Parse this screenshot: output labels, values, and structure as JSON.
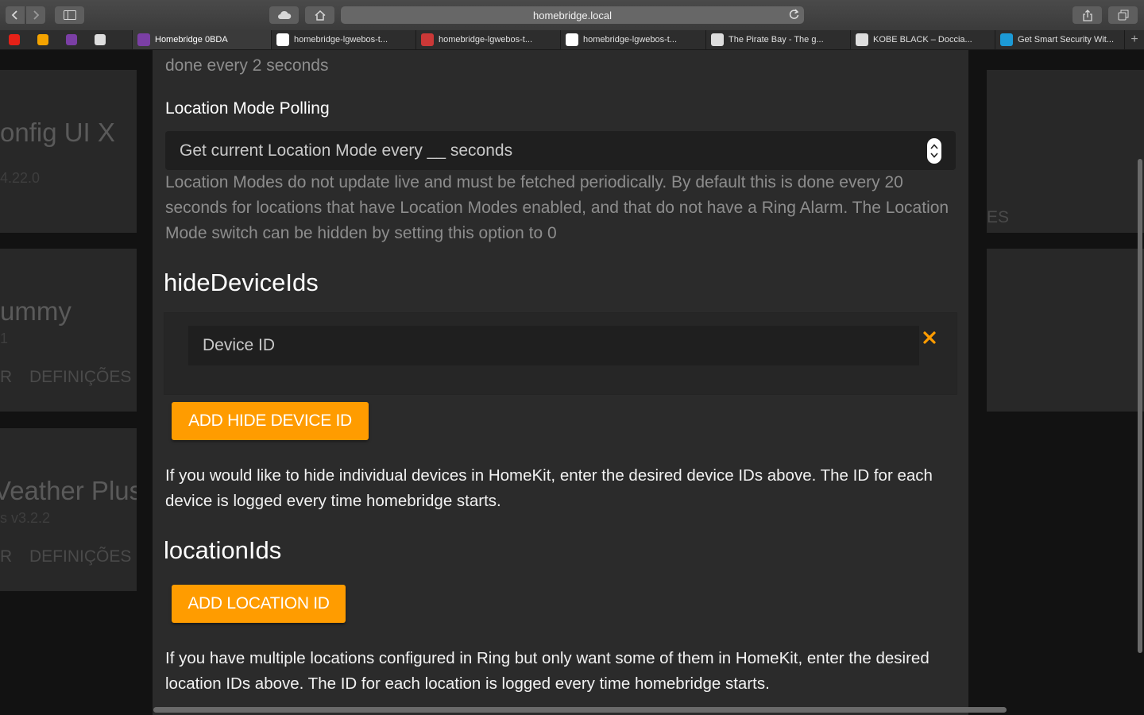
{
  "browser": {
    "address": "homebridge.local",
    "pinned": [
      {
        "name": "youtube-icon",
        "color": "#e62117"
      },
      {
        "name": "brave-lion-icon",
        "color": "#f4a300"
      },
      {
        "name": "homebridge-icon",
        "color": "#7b3fa5"
      },
      {
        "name": "library-icon",
        "color": "#dddddd"
      }
    ],
    "tabs": [
      {
        "title": "Homebridge 0BDA",
        "icon": "homebridge-icon",
        "color": "#7b3fa5",
        "active": true
      },
      {
        "title": "homebridge-lgwebos-t...",
        "icon": "github-icon",
        "color": "#ffffff",
        "active": false
      },
      {
        "title": "homebridge-lgwebos-t...",
        "icon": "npm-icon",
        "color": "#cb3837",
        "active": false
      },
      {
        "title": "homebridge-lgwebos-t...",
        "icon": "github-icon",
        "color": "#ffffff",
        "active": false
      },
      {
        "title": "The Pirate Bay - The g...",
        "icon": "pirate-ship-icon",
        "color": "#dddddd",
        "active": false
      },
      {
        "title": "KOBE BLACK – Doccia...",
        "icon": "globe-icon",
        "color": "#dddddd",
        "active": false
      },
      {
        "title": "Get Smart Security Wit...",
        "icon": "ring-icon",
        "color": "#1c9ad6",
        "active": false
      }
    ]
  },
  "background": {
    "card1_title": "onfig UI X",
    "card1_sub": "4.22.0",
    "card2_title": "ummy",
    "card2_sub": "1",
    "card2_action_left": "R",
    "card2_action": "DEFINIÇÕES",
    "card3_title": "Veather Plus",
    "card3_sub": "s v3.2.2",
    "card3_action_left": "R",
    "card3_action": "DEFINIÇÕES",
    "right_partial": "ES"
  },
  "form": {
    "prev_help_tail": "done every 2 seconds",
    "location_mode_label": "Location Mode Polling",
    "location_mode_placeholder": "Get current Location Mode every __ seconds",
    "location_mode_help": "Location Modes do not update live and must be fetched periodically. By default this is done every 20 seconds for locations that have Location Modes enabled, and that do not have a Ring Alarm. The Location Mode switch can be hidden by setting this option to 0",
    "hide_device_ids_title": "hideDeviceIds",
    "device_id_placeholder": "Device ID",
    "add_hide_device_button": "ADD HIDE DEVICE ID",
    "hide_device_desc": "If you would like to hide individual devices in HomeKit, enter the desired device IDs above. The ID for each device is logged every time homebridge starts.",
    "location_ids_title": "locationIds",
    "add_location_button": "ADD LOCATION ID",
    "location_ids_desc": "If you have multiple locations configured in Ring but only want some of them in HomeKit, enter the desired location IDs above. The ID for each location is logged every time homebridge starts."
  },
  "colors": {
    "accent": "#ff9c00",
    "modal_bg": "#2b2b2b"
  }
}
